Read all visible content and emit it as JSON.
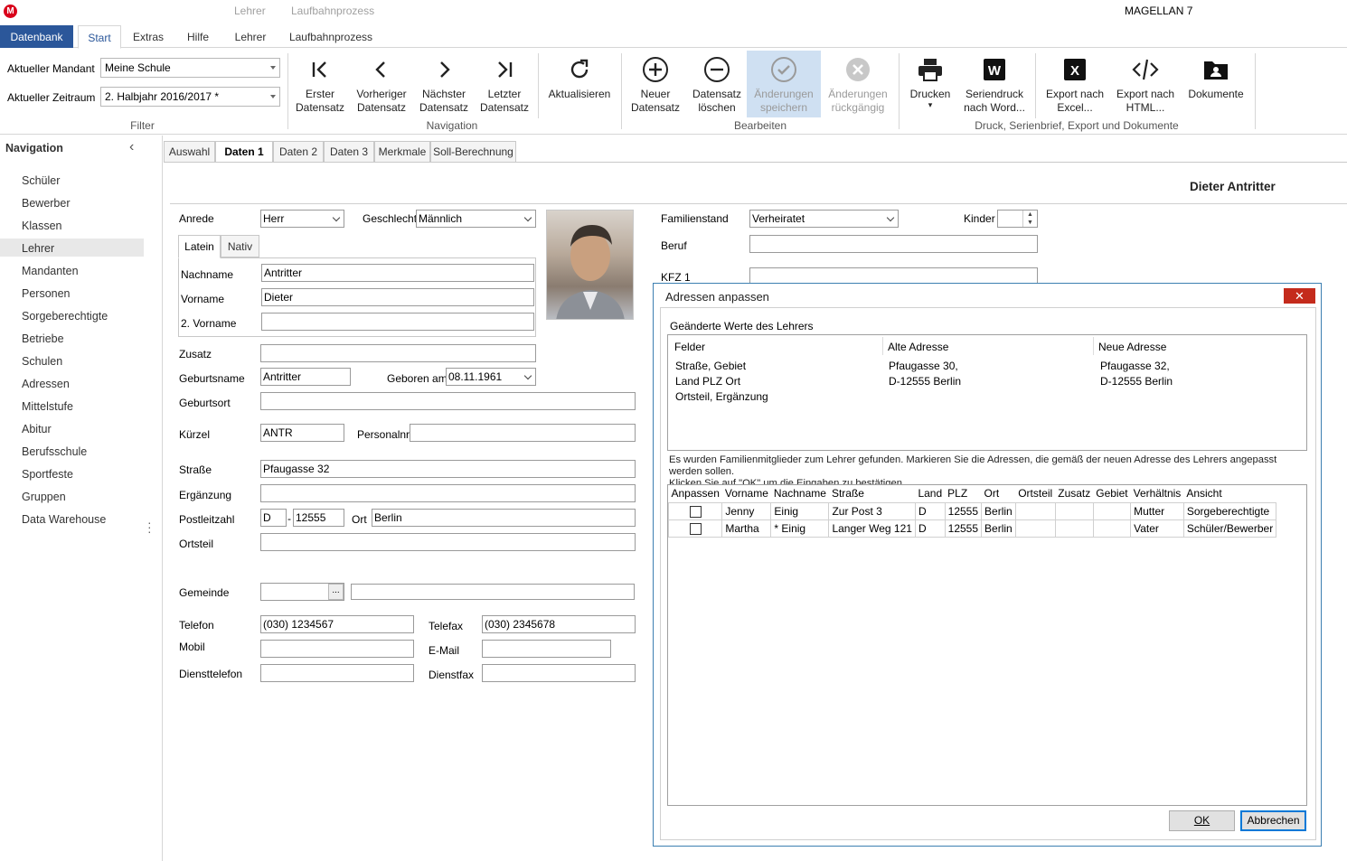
{
  "app": {
    "title": "MAGELLAN 7",
    "logo_letter": "M",
    "context_tabs": [
      "Lehrer",
      "Laufbahnprozess"
    ]
  },
  "menu": {
    "tabs": [
      "Datenbank",
      "Start",
      "Extras",
      "Hilfe",
      "Lehrer",
      "Laufbahnprozess"
    ],
    "active": "Start"
  },
  "filter": {
    "mandant_label": "Aktueller Mandant",
    "mandant_value": "Meine Schule",
    "zeitraum_label": "Aktueller Zeitraum",
    "zeitraum_value": "2. Halbjahr 2016/2017 *",
    "group": "Filter"
  },
  "ribbon": {
    "navigation": {
      "group": "Navigation",
      "first": [
        "Erster",
        "Datensatz"
      ],
      "prev": [
        "Vorheriger",
        "Datensatz"
      ],
      "next": [
        "Nächster",
        "Datensatz"
      ],
      "last": [
        "Letzter",
        "Datensatz"
      ],
      "refresh": "Aktualisieren"
    },
    "bearbeiten": {
      "group": "Bearbeiten",
      "new": [
        "Neuer",
        "Datensatz"
      ],
      "delete": [
        "Datensatz",
        "löschen"
      ],
      "save": [
        "Änderungen",
        "speichern"
      ],
      "undo": [
        "Änderungen",
        "rückgängig"
      ]
    },
    "druck": {
      "group": "Druck, Serienbrief, Export und Dokumente",
      "print": "Drucken",
      "word": [
        "Seriendruck",
        "nach Word..."
      ],
      "excel": [
        "Export nach",
        "Excel..."
      ],
      "html": [
        "Export nach",
        "HTML..."
      ],
      "docs": "Dokumente"
    }
  },
  "navigation": {
    "title": "Navigation",
    "items": [
      "Schüler",
      "Bewerber",
      "Klassen",
      "Lehrer",
      "Mandanten",
      "Personen",
      "Sorgeberechtigte",
      "Betriebe",
      "Schulen",
      "Adressen",
      "Mittelstufe",
      "Abitur",
      "Berufsschule",
      "Sportfeste",
      "Gruppen",
      "Data Warehouse"
    ],
    "selected": "Lehrer"
  },
  "tabs": [
    "Auswahl",
    "Daten 1",
    "Daten 2",
    "Daten 3",
    "Merkmale",
    "Soll-Berechnung"
  ],
  "record_name": "Dieter Antritter",
  "form": {
    "anrede_label": "Anrede",
    "anrede": "Herr",
    "geschlecht_label": "Geschlecht",
    "geschlecht": "Männlich",
    "subtabs": [
      "Latein",
      "Nativ"
    ],
    "nachname_label": "Nachname",
    "nachname": "Antritter",
    "vorname_label": "Vorname",
    "vorname": "Dieter",
    "vorname2_label": "2. Vorname",
    "vorname2": "",
    "zusatz_label": "Zusatz",
    "zusatz": "",
    "geburtsname_label": "Geburtsname",
    "geburtsname": "Antritter",
    "geboren_label": "Geboren am",
    "geboren": "08.11.1961",
    "geburtsort_label": "Geburtsort",
    "geburtsort": "",
    "kuerzel_label": "Kürzel",
    "kuerzel": "ANTR",
    "personalnr_label": "Personalnr",
    "personalnr": "",
    "strasse_label": "Straße",
    "strasse": "Pfaugasse 32",
    "ergaenzung_label": "Ergänzung",
    "ergaenzung": "",
    "plz_label": "Postleitzahl",
    "land": "D",
    "plz_sep": "-",
    "plz": "12555",
    "ort_label": "Ort",
    "ort": "Berlin",
    "ortsteil_label": "Ortsteil",
    "ortsteil": "",
    "gemeinde_label": "Gemeinde",
    "gemeinde_btn": "...",
    "telefon_label": "Telefon",
    "telefon": "(030) 1234567",
    "telefax_label": "Telefax",
    "telefax": "(030) 2345678",
    "mobil_label": "Mobil",
    "email_label": "E-Mail",
    "diensttelefon_label": "Diensttelefon",
    "dienstfax_label": "Dienstfax",
    "familienstand_label": "Familienstand",
    "familienstand": "Verheiratet",
    "kinder_label": "Kinder",
    "beruf_label": "Beruf",
    "kfz_label": "KFZ 1"
  },
  "dialog": {
    "title": "Adressen anpassen",
    "close": "✕",
    "changed_title": "Geänderte Werte des Lehrers",
    "cols": [
      "Felder",
      "Alte Adresse",
      "Neue Adresse"
    ],
    "felder": [
      "Straße, Gebiet",
      "Land PLZ Ort",
      "Ortsteil, Ergänzung"
    ],
    "alt": [
      "Pfaugasse 30,",
      "D-12555 Berlin"
    ],
    "neu": [
      "Pfaugasse 32,",
      "D-12555 Berlin"
    ],
    "info1": "Es wurden Familienmitglieder zum Lehrer gefunden. Markieren Sie die Adressen, die gemäß der neuen Adresse des Lehrers angepasst werden sollen.",
    "info2": "Klicken Sie auf \"OK\" um die Eingaben zu bestätigen.",
    "grid_headers": [
      "Anpassen",
      "Vorname",
      "Nachname",
      "Straße",
      "Land",
      "PLZ",
      "Ort",
      "Ortsteil",
      "Zusatz",
      "Gebiet",
      "Verhältnis",
      "Ansicht"
    ],
    "rows": [
      [
        "",
        "Jenny",
        "Einig",
        "Zur Post 3",
        "D",
        "12555",
        "Berlin",
        "",
        "",
        "",
        "Mutter",
        "Sorgeberechtigte"
      ],
      [
        "",
        "Martha",
        "* Einig",
        "Langer Weg 121",
        "D",
        "12555",
        "Berlin",
        "",
        "",
        "",
        "Vater",
        "Schüler/Bewerber"
      ]
    ],
    "ok": "OK",
    "cancel": "Abbrechen"
  }
}
